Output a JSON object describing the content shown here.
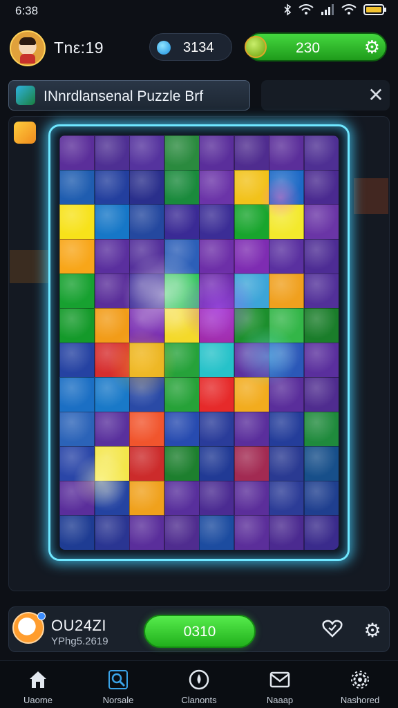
{
  "status_bar": {
    "time": "6:38"
  },
  "header": {
    "player_name": "Tnε:19",
    "gems": "3134",
    "coins": "230"
  },
  "banner": {
    "title": "INnrdlansenal Puzzle Brf"
  },
  "board": {
    "frame_color": "#6fe7ff",
    "tiles": [
      [
        "#5b2e9a",
        "#4e2f93",
        "#55339e",
        "#2a8a3e",
        "#5a2e9b",
        "#4f2c8f",
        "#5b2e9a",
        "#4e2f93"
      ],
      [
        "#1f5db0",
        "#233f9e",
        "#2a2f8c",
        "#1a8a3c",
        "#6b34a8",
        "#f2c21a",
        "#1e6ac6",
        "#4a2a90"
      ],
      [
        "#f7e21a",
        "#1677c7",
        "#24489f",
        "#3a2a95",
        "#3b2d96",
        "#18a52d",
        "#f3e92c",
        "#6a35a6"
      ],
      [
        "#f8a619",
        "#5a2f9e",
        "#54309b",
        "#2c5fb8",
        "#6d2fa8",
        "#7e2cb2",
        "#5a30a0",
        "#4d2c94"
      ],
      [
        "#17a130",
        "#5a2e9a",
        "#3c2a98",
        "#2fc45a",
        "#6a2ba6",
        "#3ca5d8",
        "#f0a01e",
        "#523099"
      ],
      [
        "#149a2a",
        "#f29c18",
        "#7a2fb2",
        "#f4d92a",
        "#a02aa8",
        "#1c8f2d",
        "#33b648",
        "#1a7d2a"
      ],
      [
        "#2542a2",
        "#d62d2d",
        "#e8b21e",
        "#26a23a",
        "#26c2c9",
        "#5c30a0",
        "#2b58b8",
        "#5a2f9d"
      ],
      [
        "#1b6fc4",
        "#1979c8",
        "#2a4aa6",
        "#26a238",
        "#e62a2a",
        "#f2ac1e",
        "#5a2e9b",
        "#4f2c8f"
      ],
      [
        "#2b63b8",
        "#59309d",
        "#f1552d",
        "#274bb0",
        "#2a3c9a",
        "#5a2e9c",
        "#243d9a",
        "#1f8a3c"
      ],
      [
        "#2a46a8",
        "#f4e64a",
        "#cc2b2b",
        "#1d7f2e",
        "#213a95",
        "#a22a52",
        "#2a3a92",
        "#174f8a"
      ],
      [
        "#5a2e9b",
        "#2443a1",
        "#f0a11c",
        "#582f9c",
        "#4b2b92",
        "#5b2e9a",
        "#2c3c97",
        "#1f3f8f"
      ],
      [
        "#1e3c93",
        "#2a3592",
        "#5a2e9b",
        "#4f2c8f",
        "#1c4ca0",
        "#5b2e9a",
        "#4b2a90",
        "#3a2b8c"
      ]
    ]
  },
  "bottom_bar": {
    "name": "OU24ZI",
    "subtitle": "YPhg5.2619",
    "score": "0310"
  },
  "nav": [
    {
      "label": "Uaome",
      "icon": "home-icon"
    },
    {
      "label": "Norsale",
      "icon": "search-icon"
    },
    {
      "label": "Clanonts",
      "icon": "compass-icon"
    },
    {
      "label": "Naaap",
      "icon": "mail-icon"
    },
    {
      "label": "Nashored",
      "icon": "settings-icon"
    }
  ]
}
